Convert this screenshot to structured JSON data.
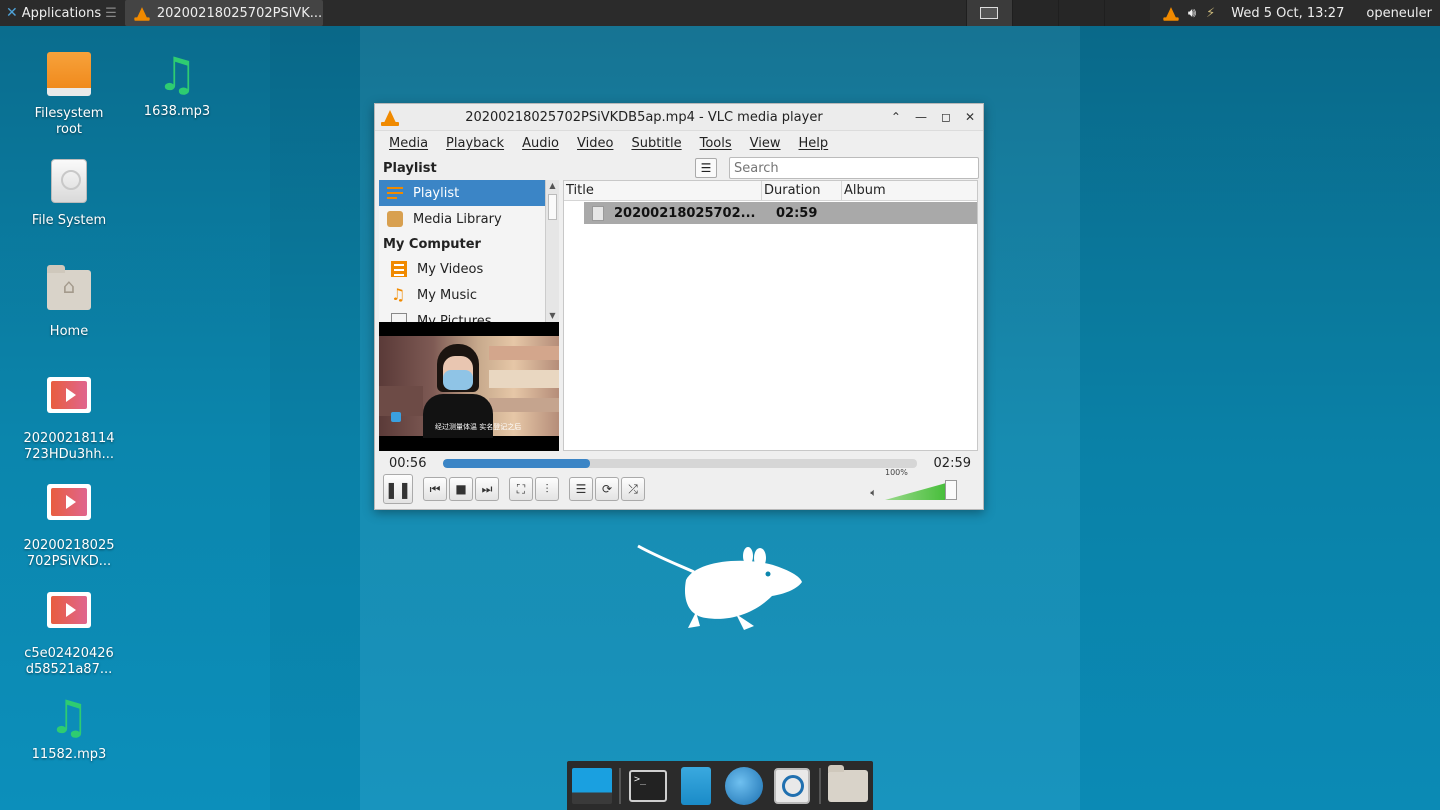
{
  "top_panel": {
    "applications_label": "Applications",
    "task_title": "20200218025702PSiVK...",
    "clock": "Wed   5 Oct, 13:27",
    "user": "openeuler"
  },
  "desktop": {
    "icons": [
      {
        "label": "Filesystem\nroot",
        "icon": "drive-icon"
      },
      {
        "label": "1638.mp3",
        "icon": "music-icon"
      },
      {
        "label": "File System",
        "icon": "disk-icon"
      },
      {
        "label": "Home",
        "icon": "home-folder-icon"
      },
      {
        "label": "20200218114\n723HDu3hh...",
        "icon": "video-file-icon"
      },
      {
        "label": "20200218025\n702PSiVKD...",
        "icon": "video-file-icon"
      },
      {
        "label": "c5e02420426\nd58521a87...",
        "icon": "video-file-icon"
      },
      {
        "label": "11582.mp3",
        "icon": "music-icon"
      }
    ]
  },
  "vlc": {
    "title": "20200218025702PSiVKDB5ap.mp4 - VLC media player",
    "menu": [
      "Media",
      "Playback",
      "Audio",
      "Video",
      "Subtitle",
      "Tools",
      "View",
      "Help"
    ],
    "playlist_header": "Playlist",
    "search_placeholder": "Search",
    "sidebar": {
      "items": [
        "Playlist",
        "Media Library"
      ],
      "section": "My Computer",
      "sub_items": [
        "My Videos",
        "My Music",
        "My Pictures"
      ]
    },
    "thumb_subtitle": "经过测量体温 实名登记之后",
    "columns": [
      "Title",
      "Duration",
      "Album"
    ],
    "rows": [
      {
        "title": "20200218025702...",
        "duration": "02:59",
        "album": ""
      }
    ],
    "time_current": "00:56",
    "time_total": "02:59",
    "progress": 0.31,
    "volume_label": "100%",
    "volume": 1.0
  },
  "colors": {
    "accent": "#3b85c6",
    "vlc_orange": "#f08a00"
  }
}
